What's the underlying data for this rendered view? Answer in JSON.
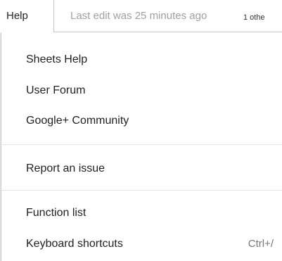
{
  "menubar": {
    "help_label": "Help",
    "last_edit": "Last edit was 25 minutes ago",
    "others": "1 othe"
  },
  "menu": {
    "items": [
      {
        "label": "Sheets Help"
      },
      {
        "label": "User Forum"
      },
      {
        "label": "Google+ Community"
      },
      {
        "label": "Report an issue"
      },
      {
        "label": "Function list"
      },
      {
        "label": "Keyboard shortcuts",
        "shortcut": "Ctrl+/"
      }
    ]
  }
}
